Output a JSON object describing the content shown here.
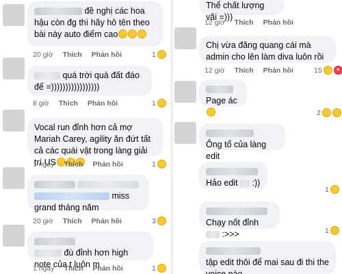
{
  "actions": {
    "like": "Thích",
    "reply": "Phản hồi"
  },
  "left": [
    {
      "text": "đề nghị các hoa hậu còn đg thì hãy hô tên theo bài này auto điểm cao",
      "emojis": 3,
      "time": "20 giờ",
      "react_count": "1",
      "react": [
        "laugh-icon"
      ]
    },
    {
      "text": "quá trời quá đất đáo để =)))))))))))))))))",
      "time": "8 giờ",
      "react_count": "1",
      "react": [
        "laugh-icon"
      ]
    },
    {
      "text": "Vocal run đỉnh hơn cả mợ Mariah Carey, agility ăn đứt tất cả các quái vật trong làng giải trí US",
      "emojis": 3,
      "time": "1 ngày",
      "react_count": "1",
      "react": [
        "laugh-icon"
      ]
    },
    {
      "text": "miss grand tháng năm",
      "time": "20 giờ",
      "react_count": "3",
      "react": [
        "laugh-icon"
      ]
    },
    {
      "text": "đù đỉnh hơn high note của t luôn m",
      "time": "1 ngày",
      "react_count": "1",
      "react": [
        "laugh-icon"
      ]
    }
  ],
  "right": [
    {
      "text": "Thể chất lượng vãi =)))",
      "time": "12 giờ",
      "react_count": "",
      "react": []
    },
    {
      "text": "Chị vừa đăng quang cái mà admin cho lên làm diva luôn rồi",
      "time": "12 giờ",
      "react_count": "15",
      "react": [
        "laugh-icon",
        "love-icon"
      ]
    },
    {
      "text": "Page ác",
      "emojis": 1,
      "time": "12 giờ",
      "react_count": "2",
      "react": [
        "laugh-icon",
        "sad-icon"
      ]
    },
    {
      "text": "Ông tổ của làng edit",
      "time": "12 giờ",
      "react_count": "",
      "react": []
    },
    {
      "text": "Hảo edit",
      "tail": ":))",
      "time": "12 giờ",
      "react_count": "1",
      "react": [
        "laugh-icon"
      ]
    },
    {
      "text": "Chạy nốt đỉnh",
      "tail": ":>>>",
      "time": "12 giờ",
      "react_count": "1",
      "react": [
        "sad-icon"
      ]
    },
    {
      "text": "tập edit thôi để mai sau đi thi the voice nào",
      "time": "",
      "react_count": "",
      "react": []
    }
  ]
}
